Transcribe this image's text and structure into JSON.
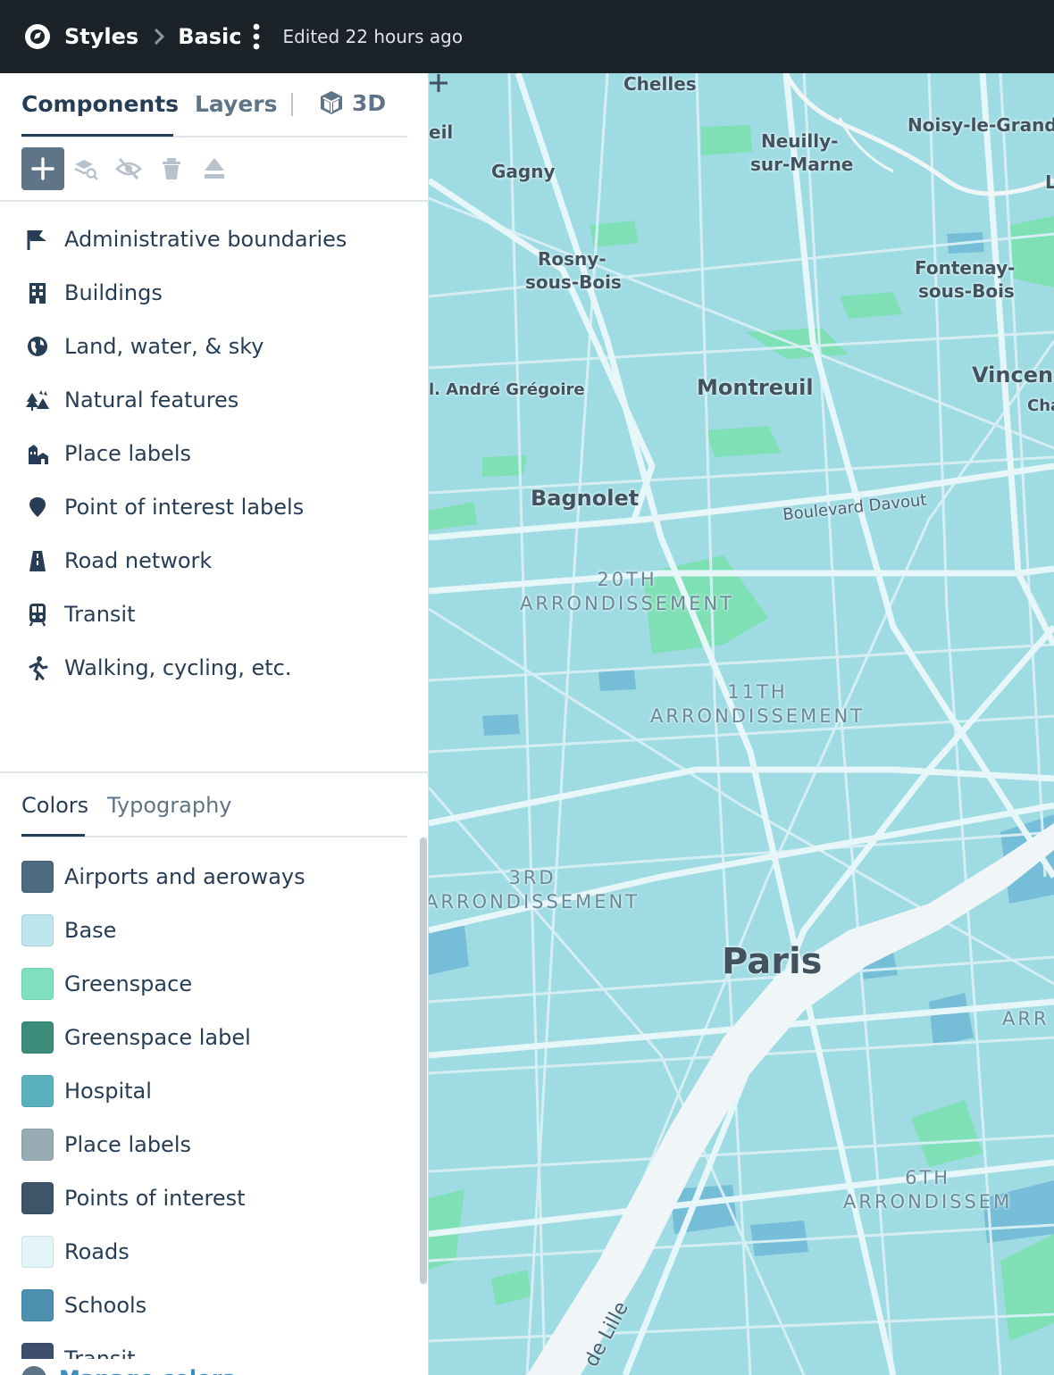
{
  "header": {
    "breadcrumb_root": "Styles",
    "breadcrumb_current": "Basic",
    "edited_text": "Edited 22 hours ago"
  },
  "sidebar": {
    "tabs": {
      "components": "Components",
      "layers": "Layers",
      "three_d": "3D",
      "active": "Components"
    },
    "toolbar_icons": [
      "plus-icon",
      "search-layers-icon",
      "eye-off-icon",
      "trash-icon",
      "eject-icon"
    ],
    "components": [
      {
        "label": "Administrative boundaries",
        "icon": "flag-icon"
      },
      {
        "label": "Buildings",
        "icon": "building-icon"
      },
      {
        "label": "Land, water, & sky",
        "icon": "globe-icon"
      },
      {
        "label": "Natural features",
        "icon": "trees-icon"
      },
      {
        "label": "Place labels",
        "icon": "place-labels-icon"
      },
      {
        "label": "Point of interest labels",
        "icon": "map-pin-icon"
      },
      {
        "label": "Road network",
        "icon": "road-icon"
      },
      {
        "label": "Transit",
        "icon": "train-icon"
      },
      {
        "label": "Walking, cycling, etc.",
        "icon": "pedestrian-icon"
      }
    ],
    "bottom_tabs": {
      "colors": "Colors",
      "typography": "Typography",
      "active": "Colors"
    },
    "colors": [
      {
        "label": "Airports and aeroways",
        "color": "#4d6b7e"
      },
      {
        "label": "Base",
        "color": "#bde5ee"
      },
      {
        "label": "Greenspace",
        "color": "#7fe0c0"
      },
      {
        "label": "Greenspace label",
        "color": "#3b8c78"
      },
      {
        "label": "Hospital",
        "color": "#58b1bc"
      },
      {
        "label": "Place labels",
        "color": "#97abb4"
      },
      {
        "label": "Points of interest",
        "color": "#3e5468"
      },
      {
        "label": "Roads",
        "color": "#e4f5f9"
      },
      {
        "label": "Schools",
        "color": "#4c8fae"
      },
      {
        "label": "Transit",
        "color": "#3e4f6e"
      }
    ],
    "footer_label": "Manage colors"
  },
  "map": {
    "labels": {
      "chelles": "Chelles",
      "noisy": "Noisy-le-Grand",
      "neuilly_1": "Neuilly-",
      "neuilly_2": "sur-Marne",
      "gagny": "Gagny",
      "eil": "eil",
      "l_edge": "L",
      "rosny_1": "Rosny-",
      "rosny_2": "sous-Bois",
      "fontenay_1": "Fontenay-",
      "fontenay_2": "sous-Bois",
      "andre": "l. André Grégoire",
      "montreuil": "Montreuil",
      "vincennes": "Vincenn",
      "cha": "Cha",
      "bagnolet": "Bagnolet",
      "boulevard": "Boulevard Davout",
      "arr20_1": "20TH",
      "arr20_2": "ARRONDISSEMENT",
      "arr11_1": "11TH",
      "arr11_2": "ARRONDISSEMENT",
      "arr3_1": "3RD",
      "arr3_2": "ARRONDISSEMENT",
      "paris": "Paris",
      "arr_edge": "ARR",
      "arr6_1": "6TH",
      "arr6_2": "ARRONDISSEM",
      "de_lille": "de Lille"
    },
    "colors": {
      "base": "#9fdbe3",
      "road": "#e6f6f9",
      "green": "#7fe0b6",
      "water": "#f0f6f8",
      "building": "#6fb8d6"
    }
  }
}
